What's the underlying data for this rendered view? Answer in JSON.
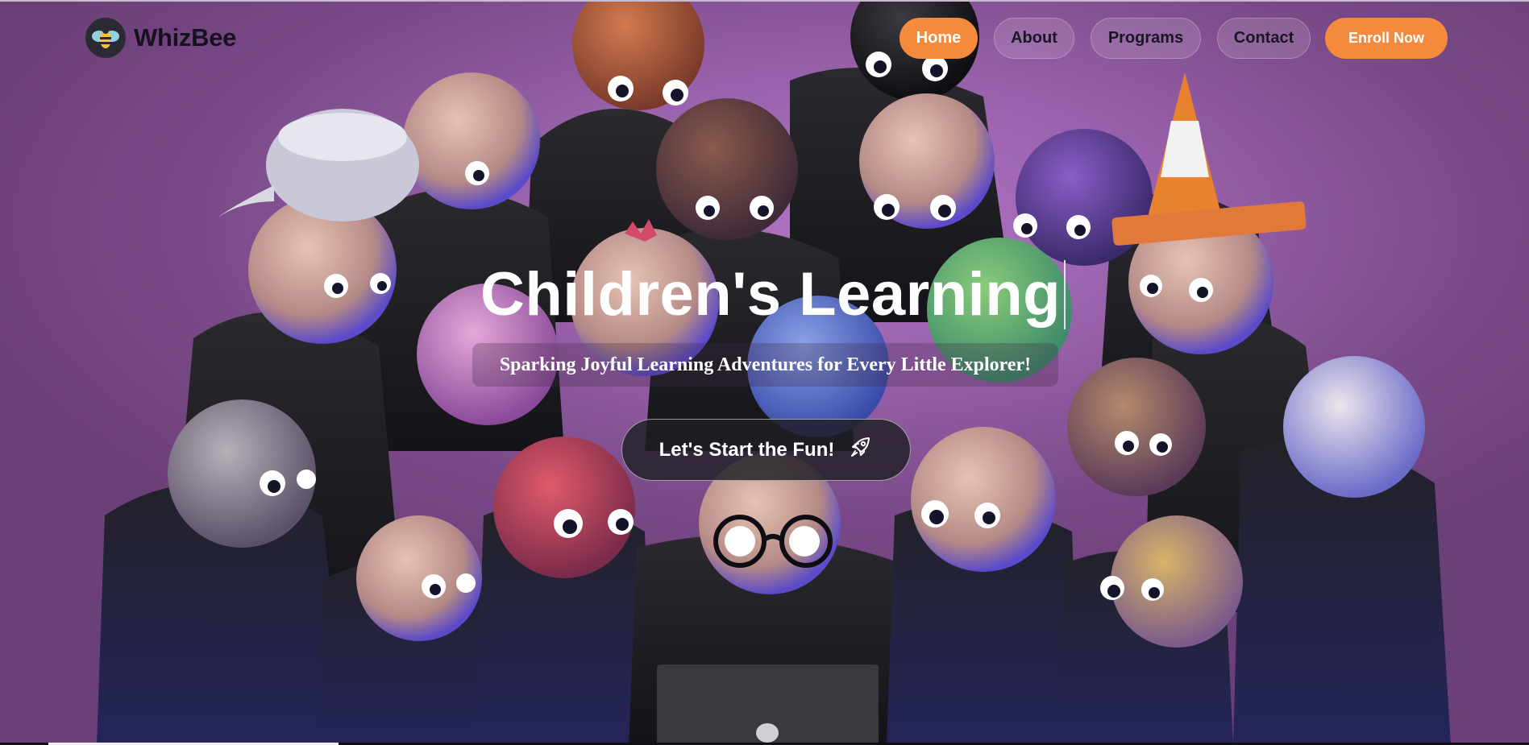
{
  "brand": {
    "name": "WhizBee",
    "logo_icon": "bee-icon"
  },
  "nav": {
    "items": [
      {
        "label": "Home",
        "active": true
      },
      {
        "label": "About",
        "active": false
      },
      {
        "label": "Programs",
        "active": false
      },
      {
        "label": "Contact",
        "active": false
      }
    ],
    "enroll_label": "Enroll Now"
  },
  "hero": {
    "title": "Children's Learning",
    "subtitle": "Sparking Joyful Learning Adventures for Every Little Explorer!",
    "cta_label": "Let's Start the Fun!",
    "cta_icon": "rocket-icon"
  },
  "colors": {
    "accent": "#f58a3c",
    "background": "#9a62ac",
    "text_dark": "#15121f",
    "text_light": "#ffffff"
  }
}
